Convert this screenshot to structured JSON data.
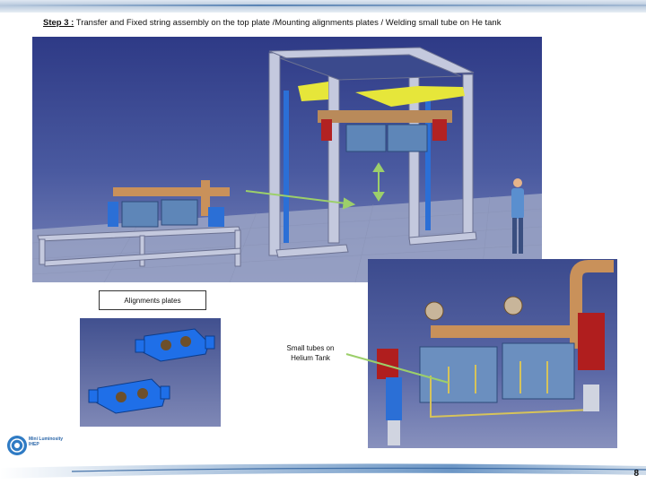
{
  "slide": {
    "title_step": "Step 3 :",
    "title_text": " Transfer and Fixed string assembly on the top plate /Mounting alignments plates / Welding small tube on He tank",
    "page_number": "8"
  },
  "callouts": {
    "alignment_plates": "Alignments plates",
    "small_tubes": "Small tubes on Helium Tank"
  },
  "logo": {
    "text": "Mini Luminosity IHEP"
  },
  "colors": {
    "render_background": "#3b4a8d",
    "arrow": "#9ccf6a",
    "frame": "#b8bfd8",
    "accent_yellow": "#e6e63a",
    "part_blue": "#2b6fd6"
  }
}
